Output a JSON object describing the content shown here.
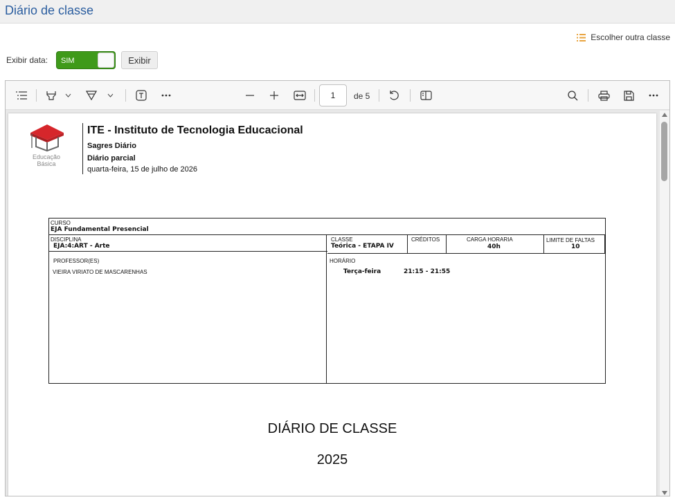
{
  "app": {
    "title": "Diário de classe"
  },
  "controls": {
    "choose_other_class": "Escolher outra classe",
    "show_date_label": "Exibir data:",
    "toggle_label": "SIM",
    "show_button": "Exibir"
  },
  "viewer": {
    "page_number": "1",
    "page_of": "de 5"
  },
  "document": {
    "logo_caption_line1": "Educação",
    "logo_caption_line2": "Básica",
    "institution": "ITE - Instituto de Tecnologia Educacional",
    "system": "Sagres Diário",
    "report": "Diário parcial",
    "date": "quarta-feira, 15 de julho de 2026",
    "course_label": "CURSO",
    "course_value": "EJA Fundamental  Presencial",
    "discipline_label": "DISCIPLINA",
    "discipline_value": "EJA:4:ART - Arte",
    "class_label": "CLASSE",
    "class_value": "Teórica - ETAPA IV",
    "credits_label": "CRÉDITOS",
    "workload_label": "CARGA HORARIA",
    "workload_value": "40h",
    "absence_label": "LIMITE DE FALTAS",
    "absence_value": "10",
    "teachers_label": "PROFESSOR(ES)",
    "teacher_name": "VIEIRA VIRIATO DE MASCARENHAS",
    "schedule_label": "HORÁRIO",
    "schedule_day": "Terça-feira",
    "schedule_time": "21:15 - 21:55",
    "main_title": "DIÁRIO DE CLASSE",
    "year": "2025"
  },
  "colors": {
    "title_blue": "#2a5d9f",
    "toggle_green": "#3f9a1a",
    "list_icon_orange": "#e8a33d",
    "logo_red": "#d6262b"
  }
}
